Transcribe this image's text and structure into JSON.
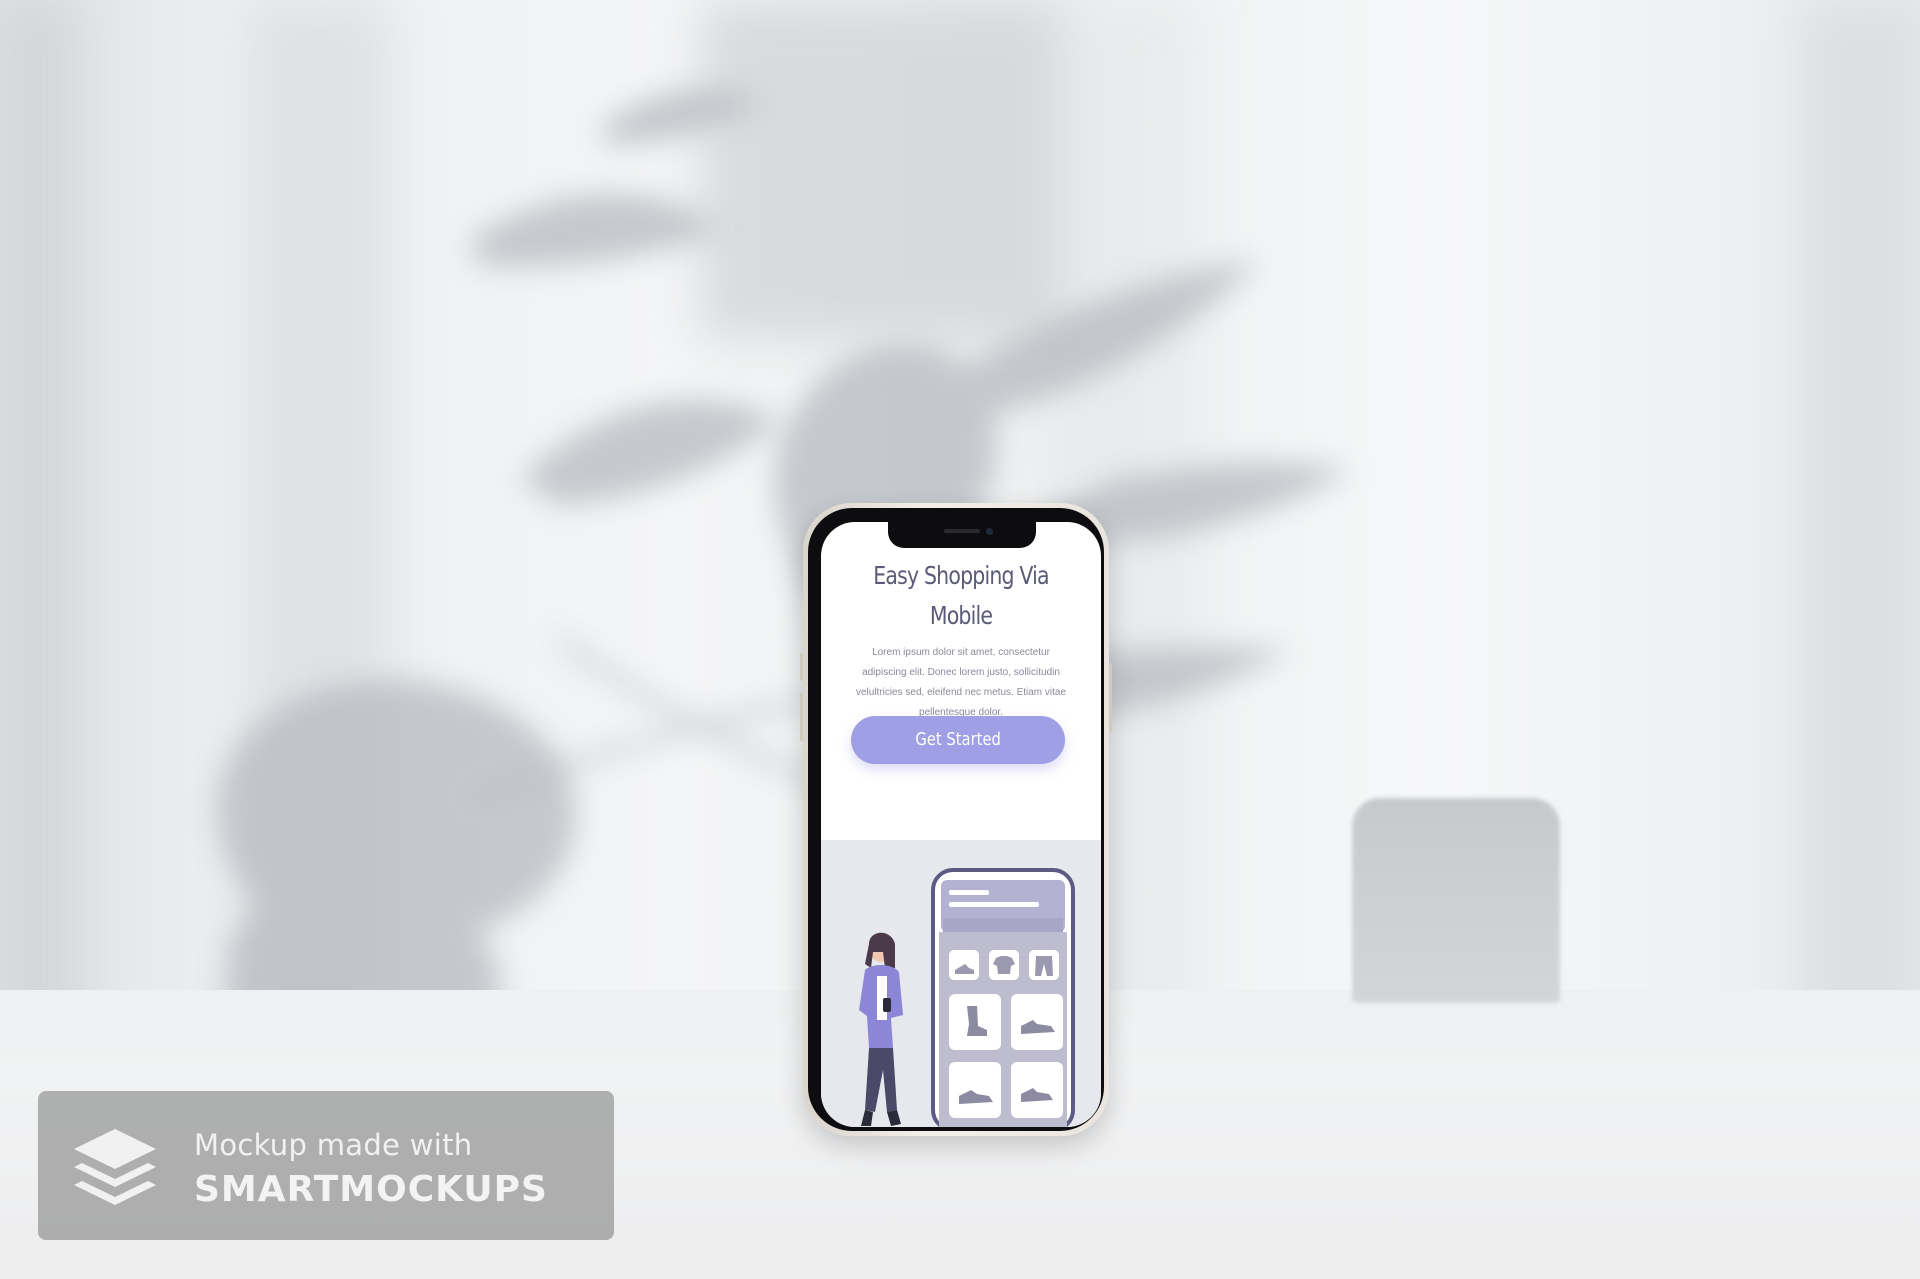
{
  "phone_screen": {
    "title": "Easy Shopping Via Mobile",
    "body": "Lorem ipsum dolor sit amet, consectetur adipiscing elit. Donec lorem justo, sollicitudin velultricies sed, eleifend nec metus. Etiam vitae pellentesque dolor.",
    "cta_label": "Get Started"
  },
  "watermark": {
    "line1": "Mockup made with",
    "line2": "SMARTMOCKUPS"
  },
  "colors": {
    "accent": "#9e9fe4",
    "title_text": "#5b5b78",
    "illustration_bg": "#e7e7ee",
    "illustration_figure": "#8b86d6"
  },
  "icons": [
    "layers-icon",
    "shoe-icon",
    "tshirt-icon",
    "pants-icon",
    "boot-icon",
    "sneaker-icon"
  ]
}
